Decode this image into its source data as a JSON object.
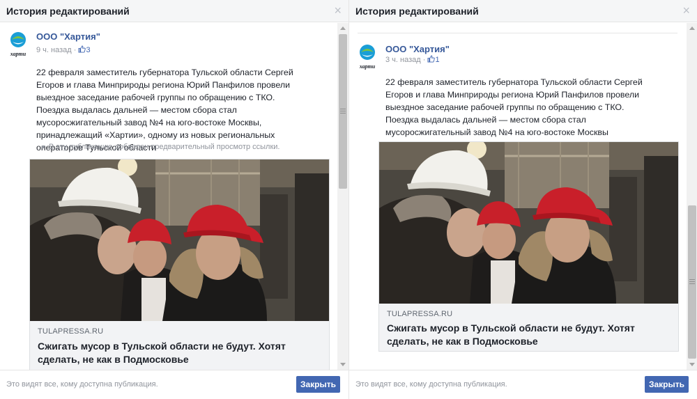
{
  "left": {
    "title": "История редактирований",
    "post": {
      "page_name": "ООО \"Хартия\"",
      "time": "9 ч. назад",
      "separator": "·",
      "likes": "3",
      "text": "22 февраля заместитель губернатора Тульской области Сергей Егоров и глава Минприроды региона Юрий Панфилов провели выездное заседание рабочей группы по обращению с ТКО. Поездка выдалась дальней — местом сбора стал мусоросжигательный завод №4 на юго-востоке Москвы, принадлежащий «Хартии», одному из новых региональных операторов Тульской области",
      "preview_note": "В эту публикацию добавлен предварительный просмотр ссылки.",
      "link": {
        "domain": "TULAPRESSA.RU",
        "title": "Сжигать мусор в Тульской области не будут. Хотят сделать, не как в Подмосковье"
      }
    },
    "footer_text": "Это видят все, кому доступна публикация.",
    "close_label": "Закрыть"
  },
  "right": {
    "title": "История редактирований",
    "post": {
      "page_name": "ООО \"Хартия\"",
      "time": "3 ч. назад",
      "separator": "·",
      "likes": "1",
      "text": "22 февраля заместитель губернатора Тульской области Сергей Егоров и глава Минприроды региона Юрий Панфилов провели выездное заседание рабочей группы по обращению с ТКО. Поездка выдалась дальней — местом сбора стал мусоросжигательный завод №4 на юго-востоке Москвы",
      "link": {
        "domain": "TULAPRESSA.RU",
        "title": "Сжигать мусор в Тульской области не будут. Хотят сделать, не как в Подмосковье"
      }
    },
    "footer_text": "Это видят все, кому доступна публикация.",
    "close_label": "Закрыть"
  },
  "logo_text": "харти",
  "icons": [
    "close-icon",
    "like-icon",
    "company-logo",
    "scroll-up-arrow",
    "scroll-down-arrow"
  ],
  "colors": {
    "link": "#365899",
    "button": "#4267b2",
    "muted": "#90949c",
    "header_bg": "#f5f6f7"
  }
}
